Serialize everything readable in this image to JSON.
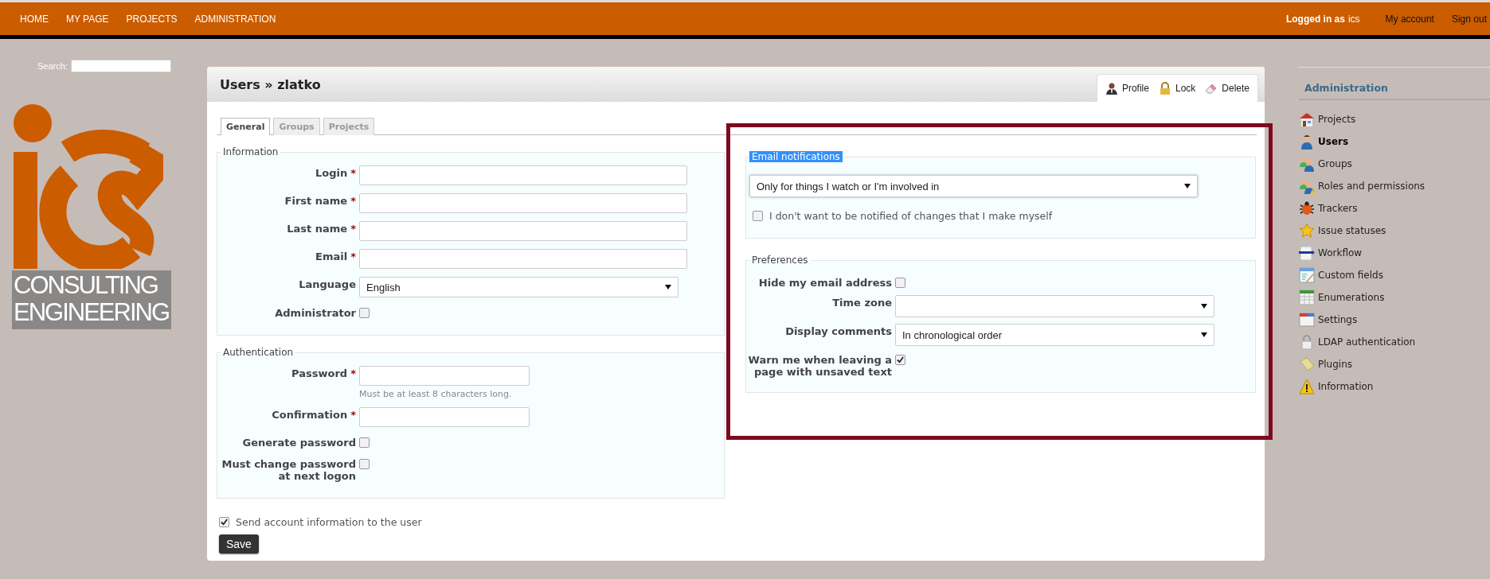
{
  "top_menu": {
    "items": [
      "HOME",
      "MY PAGE",
      "PROJECTS",
      "ADMINISTRATION"
    ],
    "logged_in_label": "Logged in as",
    "logged_in_user": "ics",
    "account_links": [
      "My account",
      "Sign out"
    ]
  },
  "search": {
    "label": "Search:"
  },
  "logo": {
    "lines": [
      "CONSULTING",
      "ENGINEERING"
    ]
  },
  "page": {
    "title": "Users » zlatko"
  },
  "actions": [
    {
      "kind": "profile",
      "label": "Profile"
    },
    {
      "kind": "lock",
      "label": "Lock"
    },
    {
      "kind": "delete",
      "label": "Delete"
    }
  ],
  "tabs": [
    {
      "label": "General",
      "selected": true
    },
    {
      "label": "Groups",
      "selected": false
    },
    {
      "label": "Projects",
      "selected": false
    }
  ],
  "information": {
    "legend": "Information",
    "fields": [
      {
        "kind": "text",
        "label": "Login",
        "required_mark": "*"
      },
      {
        "kind": "text",
        "label": "First name",
        "required_mark": "*"
      },
      {
        "kind": "text",
        "label": "Last name",
        "required_mark": "*"
      },
      {
        "kind": "text",
        "label": "Email",
        "required_mark": "*"
      },
      {
        "kind": "select",
        "label": "Language",
        "value": "English"
      },
      {
        "kind": "checkbox",
        "label": "Administrator",
        "checked": false
      }
    ]
  },
  "authentication": {
    "legend": "Authentication",
    "fields": [
      {
        "kind": "text",
        "label": "Password",
        "required_mark": "*",
        "hint": "Must be at least 8 characters long."
      },
      {
        "kind": "text",
        "label": "Confirmation",
        "required_mark": "*"
      },
      {
        "kind": "checkbox",
        "label": "Generate password",
        "checked": false
      },
      {
        "kind": "checkbox",
        "label": "Must change password at next logon",
        "checked": false
      }
    ]
  },
  "send_info": {
    "label": "Send account information to the user",
    "checked": true
  },
  "save_button": {
    "label": "Save"
  },
  "email_notifications": {
    "legend": "Email notifications",
    "legend_highlighted": true,
    "value": "Only for things I watch or I'm involved in",
    "option": {
      "label": "I don't want to be notified of changes that I make myself",
      "checked": false
    }
  },
  "preferences": {
    "legend": "Preferences",
    "fields": [
      {
        "kind": "checkbox",
        "label": "Hide my email address",
        "checked": false
      },
      {
        "kind": "select",
        "label": "Time zone"
      },
      {
        "kind": "select",
        "label": "Display comments",
        "value": "In chronological order"
      },
      {
        "kind": "checkbox",
        "label": "Warn me when leaving a page with unsaved text",
        "checked": true
      }
    ]
  },
  "sidebar": {
    "title": "Administration",
    "items": [
      {
        "kind": "house",
        "label": "Projects",
        "selected": false
      },
      {
        "kind": "user",
        "label": "Users",
        "selected": true
      },
      {
        "kind": "users",
        "label": "Groups",
        "selected": false
      },
      {
        "kind": "roles",
        "label": "Roles and permissions",
        "selected": false
      },
      {
        "kind": "bug",
        "label": "Trackers",
        "selected": false
      },
      {
        "kind": "star",
        "label": "Issue statuses",
        "selected": false
      },
      {
        "kind": "flow",
        "label": "Workflow",
        "selected": false
      },
      {
        "kind": "form",
        "label": "Custom fields",
        "selected": false
      },
      {
        "kind": "table",
        "label": "Enumerations",
        "selected": false
      },
      {
        "kind": "window",
        "label": "Settings",
        "selected": false
      },
      {
        "kind": "lock",
        "label": "LDAP authentication",
        "selected": false
      },
      {
        "kind": "plugin",
        "label": "Plugins",
        "selected": false
      },
      {
        "kind": "warning",
        "label": "Information",
        "selected": false
      }
    ]
  }
}
